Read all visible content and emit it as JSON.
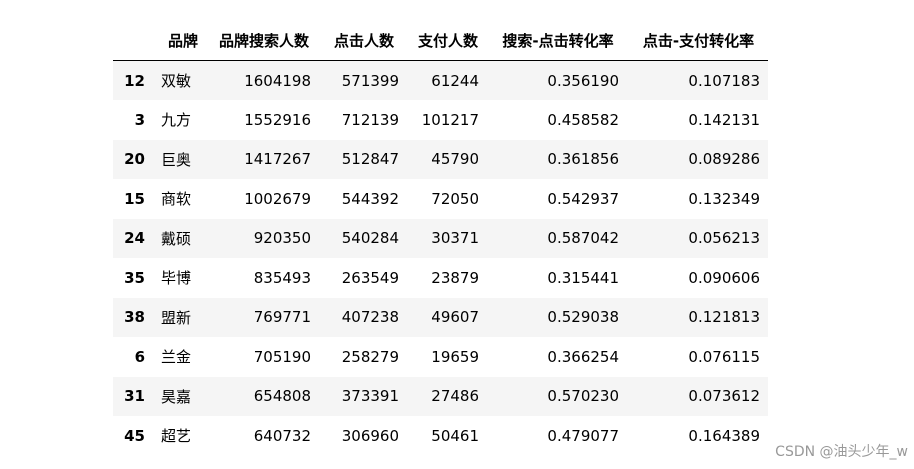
{
  "table": {
    "columns": [
      "",
      "品牌",
      "品牌搜索人数",
      "点击人数",
      "支付人数",
      "搜索-点击转化率",
      "点击-支付转化率"
    ],
    "rows": [
      {
        "index": "12",
        "brand": "双敏",
        "search": "1604198",
        "click": "571399",
        "pay": "61244",
        "search_click_rate": "0.356190",
        "click_pay_rate": "0.107183"
      },
      {
        "index": "3",
        "brand": "九方",
        "search": "1552916",
        "click": "712139",
        "pay": "101217",
        "search_click_rate": "0.458582",
        "click_pay_rate": "0.142131"
      },
      {
        "index": "20",
        "brand": "巨奥",
        "search": "1417267",
        "click": "512847",
        "pay": "45790",
        "search_click_rate": "0.361856",
        "click_pay_rate": "0.089286"
      },
      {
        "index": "15",
        "brand": "商软",
        "search": "1002679",
        "click": "544392",
        "pay": "72050",
        "search_click_rate": "0.542937",
        "click_pay_rate": "0.132349"
      },
      {
        "index": "24",
        "brand": "戴硕",
        "search": "920350",
        "click": "540284",
        "pay": "30371",
        "search_click_rate": "0.587042",
        "click_pay_rate": "0.056213"
      },
      {
        "index": "35",
        "brand": "毕博",
        "search": "835493",
        "click": "263549",
        "pay": "23879",
        "search_click_rate": "0.315441",
        "click_pay_rate": "0.090606"
      },
      {
        "index": "38",
        "brand": "盟新",
        "search": "769771",
        "click": "407238",
        "pay": "49607",
        "search_click_rate": "0.529038",
        "click_pay_rate": "0.121813"
      },
      {
        "index": "6",
        "brand": "兰金",
        "search": "705190",
        "click": "258279",
        "pay": "19659",
        "search_click_rate": "0.366254",
        "click_pay_rate": "0.076115"
      },
      {
        "index": "31",
        "brand": "昊嘉",
        "search": "654808",
        "click": "373391",
        "pay": "27486",
        "search_click_rate": "0.570230",
        "click_pay_rate": "0.073612"
      },
      {
        "index": "45",
        "brand": "超艺",
        "search": "640732",
        "click": "306960",
        "pay": "50461",
        "search_click_rate": "0.479077",
        "click_pay_rate": "0.164389"
      }
    ]
  },
  "watermark": "CSDN @油头少年_w",
  "colors": {
    "stripe": "#f5f5f5",
    "header_rule": "#000000",
    "watermark": "#999999"
  }
}
